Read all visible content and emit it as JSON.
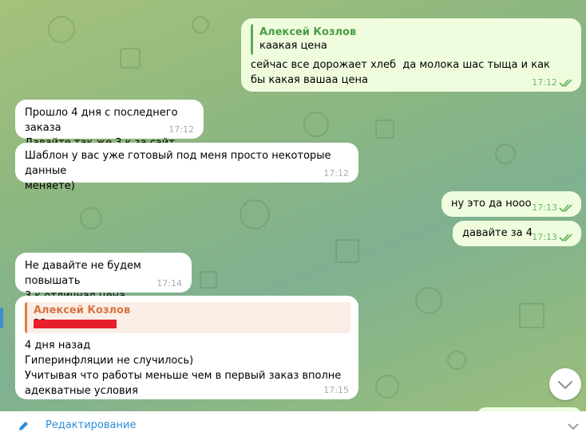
{
  "messages": [
    {
      "side": "out",
      "reply_name": "Алексей Козлов",
      "reply_text": "каакая цена",
      "text": "сейчас все дорожает хлеб  да молока шас тыща и как бы какая вашаа цена",
      "time": "17:12"
    },
    {
      "side": "in",
      "text": "Прошло 4 дня с последнего заказа\nДавайте так же 3 к за сайт",
      "time": "17:12"
    },
    {
      "side": "in",
      "text": "Шаблон у вас уже готовый под меня просто некоторые данные\nменяете)",
      "time": "17:12"
    },
    {
      "side": "out",
      "text": "ну это да нооо",
      "time": "17:13"
    },
    {
      "side": "out",
      "text": "давайте за 4",
      "time": "17:13"
    },
    {
      "side": "in",
      "text": "Не давайте не будем повышать\n3 к отличная цена",
      "time": "17:14"
    },
    {
      "side": "in",
      "reply_name": "Алексей Козлов",
      "reply_text": "22",
      "text": "4 дня назад\nГиперинфляции не случилось)\nУчитывая что работы меньше чем в первый заказ вполне\nадекватные условия",
      "time": "17:15"
    }
  ],
  "bottom_bar": {
    "label": "Редактирование"
  },
  "colors": {
    "accent": "#2b8dd6",
    "out_bubble": "#effdde",
    "in_bubble": "#ffffff",
    "redaction": "#e8202a"
  },
  "icons": [
    "double-check-icon",
    "chevron-down-icon",
    "pencil-icon"
  ]
}
